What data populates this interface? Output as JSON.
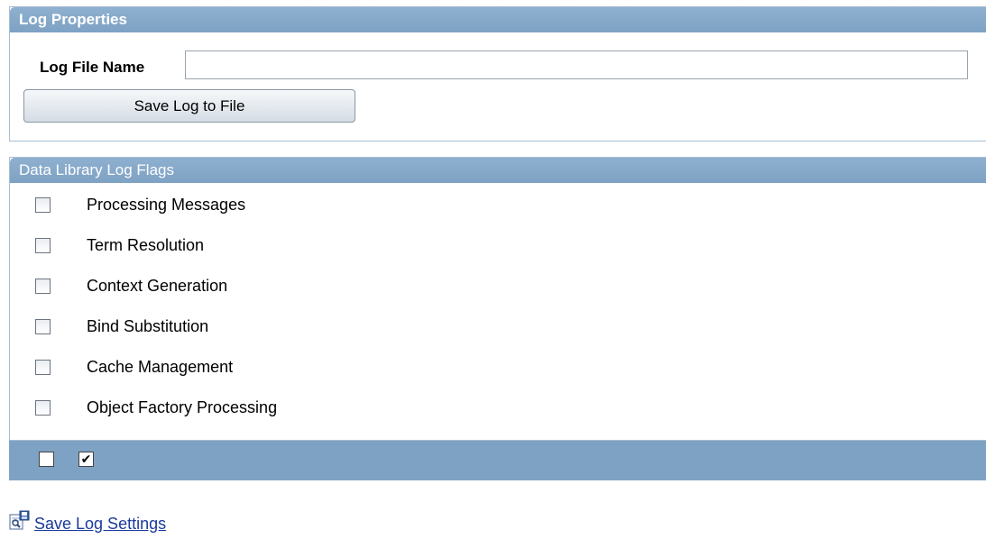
{
  "log_properties": {
    "header": "Log Properties",
    "file_name_label": "Log File Name",
    "file_name_value": "",
    "save_button_label": "Save Log to File"
  },
  "flags": {
    "header": "Data Library Log Flags",
    "items": [
      {
        "label": "Processing Messages",
        "checked": false
      },
      {
        "label": "Term Resolution",
        "checked": false
      },
      {
        "label": "Context Generation",
        "checked": false
      },
      {
        "label": "Bind Substitution",
        "checked": false
      },
      {
        "label": "Cache Management",
        "checked": false
      },
      {
        "label": "Object Factory Processing",
        "checked": false
      }
    ],
    "footer_controls": {
      "clear_all_checked": false,
      "select_all_checked": true,
      "check_glyph": "✔"
    }
  },
  "save_settings": {
    "label": "Save Log Settings",
    "icon": "save-settings-icon"
  },
  "colors": {
    "header_bg": "#7ea2c4",
    "link": "#1a3a9c"
  }
}
